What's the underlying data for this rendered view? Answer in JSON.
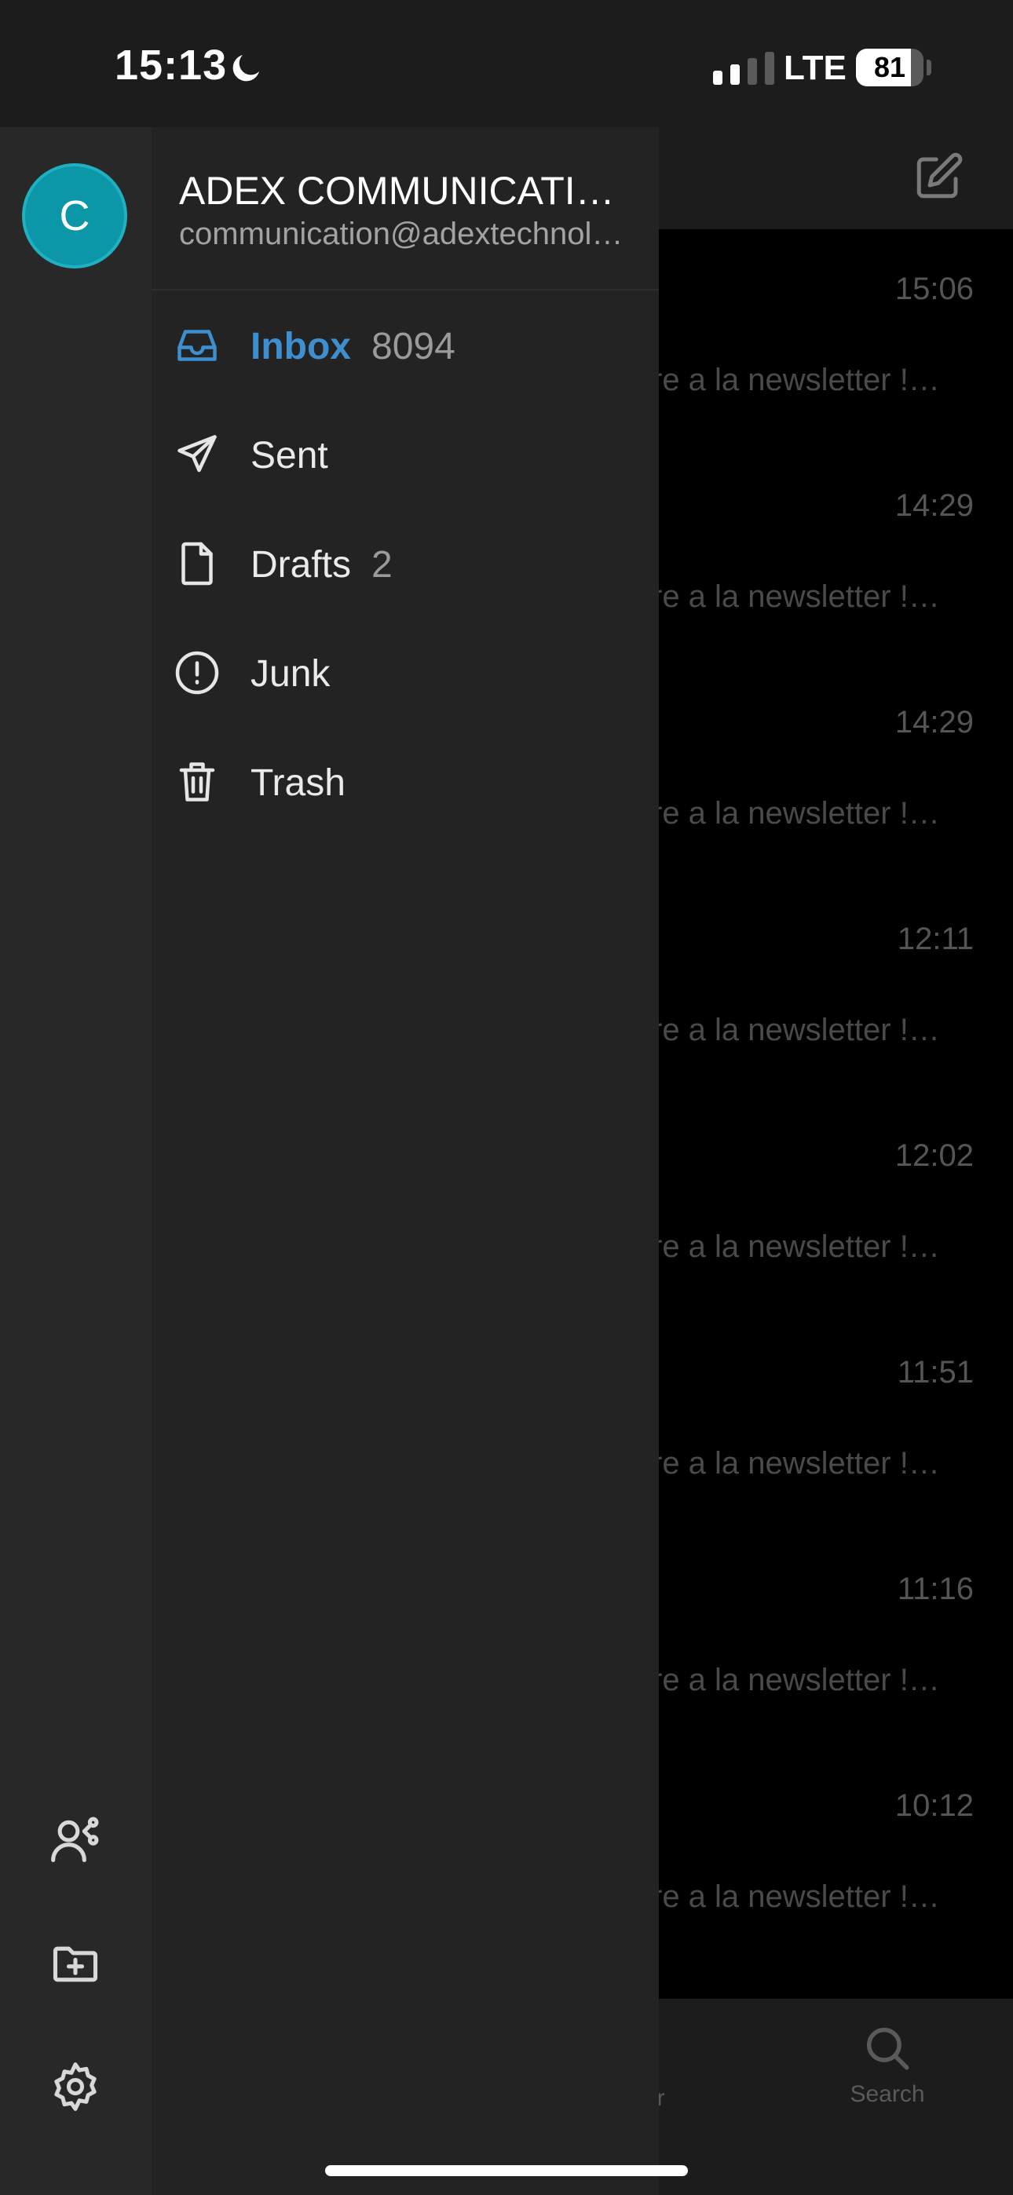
{
  "status_bar": {
    "time": "15:13",
    "network": "LTE",
    "battery": 81
  },
  "account": {
    "avatar_letter": "C",
    "name": "ADEX COMMUNICATIO…",
    "email": "communication@adextechnol…"
  },
  "folders": [
    {
      "label": "Inbox",
      "count": "8094",
      "icon": "inbox-icon"
    },
    {
      "label": "Sent",
      "count": "",
      "icon": "send-icon"
    },
    {
      "label": "Drafts",
      "count": "2",
      "icon": "file-icon"
    },
    {
      "label": "Junk",
      "count": "",
      "icon": "alert-circle-icon"
    },
    {
      "label": "Trash",
      "count": "",
      "icon": "trash-icon"
    }
  ],
  "mail_list": [
    {
      "time": "15:06",
      "preview": "re a la newsletter !…"
    },
    {
      "time": "14:29",
      "preview": "re a la newsletter !…"
    },
    {
      "time": "14:29",
      "preview": "re a la newsletter !…"
    },
    {
      "time": "12:11",
      "preview": "re a la newsletter !…"
    },
    {
      "time": "12:02",
      "preview": "re a la newsletter !…"
    },
    {
      "time": "11:51",
      "preview": "re a la newsletter !…"
    },
    {
      "time": "11:16",
      "preview": "re a la newsletter !…"
    },
    {
      "time": "10:12",
      "preview": "re a la newsletter !…"
    }
  ],
  "tab_bar": {
    "calendar_partial": "ar",
    "search_label": "Search"
  },
  "colors": {
    "accent": "#3e8fd0",
    "avatar": "#0b97a8"
  }
}
